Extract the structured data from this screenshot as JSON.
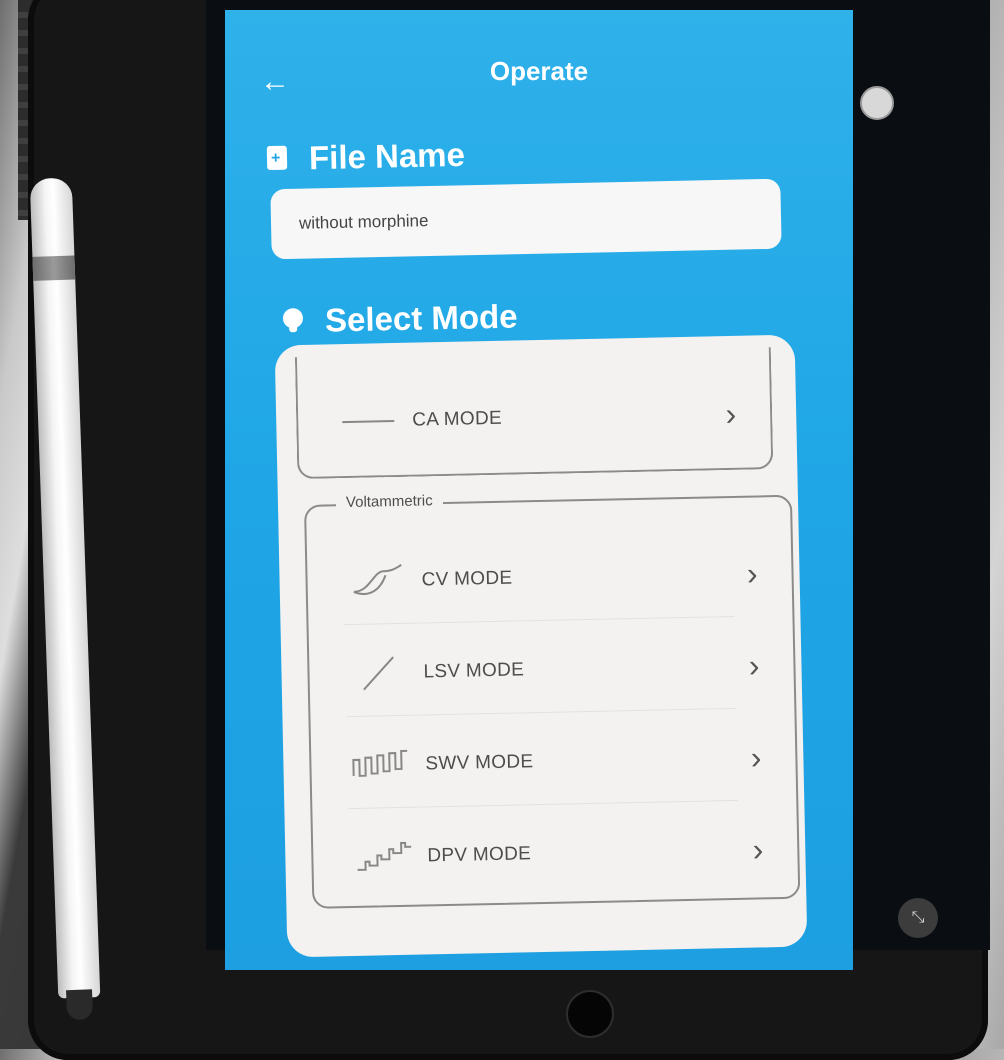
{
  "app": {
    "title": "Operate",
    "file_section": {
      "label": "File Name",
      "value": "without morphine"
    },
    "mode_section": {
      "label": "Select Mode"
    },
    "modes": [
      {
        "label": "CA MODE",
        "icon": "flat-line-icon"
      }
    ],
    "voltammetric": {
      "legend": "Voltammetric",
      "modes": [
        {
          "label": "CV MODE",
          "icon": "cyclic-curve-icon"
        },
        {
          "label": "LSV MODE",
          "icon": "linear-sweep-icon"
        },
        {
          "label": "SWV MODE",
          "icon": "square-wave-icon"
        },
        {
          "label": "DPV MODE",
          "icon": "pulse-staircase-icon"
        }
      ]
    },
    "colors": {
      "accent": "#1fa6e6",
      "panel": "#f3f2f0",
      "text": "#4d4d4d"
    }
  }
}
